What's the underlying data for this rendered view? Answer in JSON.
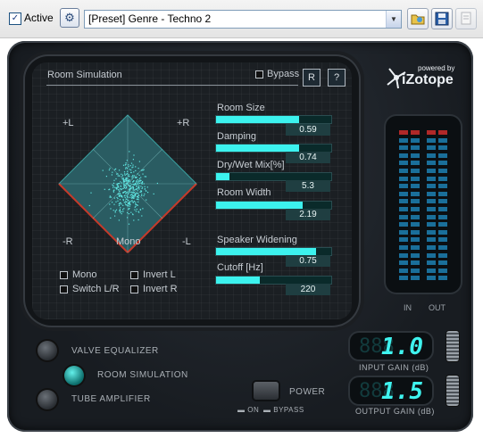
{
  "toolbar": {
    "active_label": "Active",
    "active_checked": true,
    "preset_value": "[Preset] Genre - Techno 2",
    "icons": [
      "gear-icon",
      "folder-open-icon",
      "save-icon",
      "copy-icon"
    ]
  },
  "plugin": {
    "logo_small": "powered by",
    "logo_main": "iZotope",
    "room": {
      "title": "Room Simulation",
      "bypass_label": "Bypass",
      "reset_button": "R",
      "help_button": "?",
      "vector": {
        "top_left": "+L",
        "top_right": "+R",
        "bottom_left": "-R",
        "bottom_center": "Mono",
        "bottom_right": "-L"
      },
      "options": [
        {
          "label": "Mono",
          "checked": false
        },
        {
          "label": "Invert L",
          "checked": false
        },
        {
          "label": "Switch L/R",
          "checked": false
        },
        {
          "label": "Invert R",
          "checked": false
        }
      ],
      "sliders": [
        {
          "label": "Room Size",
          "value": "0.59",
          "level": 0.72
        },
        {
          "label": "Damping",
          "value": "0.74",
          "level": 0.72
        },
        {
          "label": "Dry/Wet Mix[%]",
          "value": "5.3",
          "level": 0.12
        },
        {
          "label": "Room Width",
          "value": "2.19",
          "level": 0.75
        },
        {
          "label": "Speaker Widening",
          "value": "0.75",
          "level": 0.87
        },
        {
          "label": "Cutoff [Hz]",
          "value": "220",
          "level": 0.38
        }
      ]
    },
    "meter": {
      "in_label": "IN",
      "out_label": "OUT"
    },
    "modes": [
      {
        "label": "VALVE EQUALIZER",
        "active": false
      },
      {
        "label": "ROOM SIMULATION",
        "active": true
      },
      {
        "label": "TUBE AMPLIFIER",
        "active": false
      }
    ],
    "power": {
      "label": "POWER",
      "on_label": "ON",
      "bypass_label": "BYPASS"
    },
    "input_gain": {
      "ghost": "888",
      "value": "1.0",
      "label": "INPUT GAIN (dB)"
    },
    "output_gain": {
      "ghost": "888",
      "value": "1.5",
      "label": "OUTPUT GAIN (dB)"
    },
    "colors": {
      "accent": "#3cf2ee",
      "panel_bg": "#1b1f23",
      "meter_blue": "#1a6f9a",
      "meter_red": "#b02828"
    }
  }
}
